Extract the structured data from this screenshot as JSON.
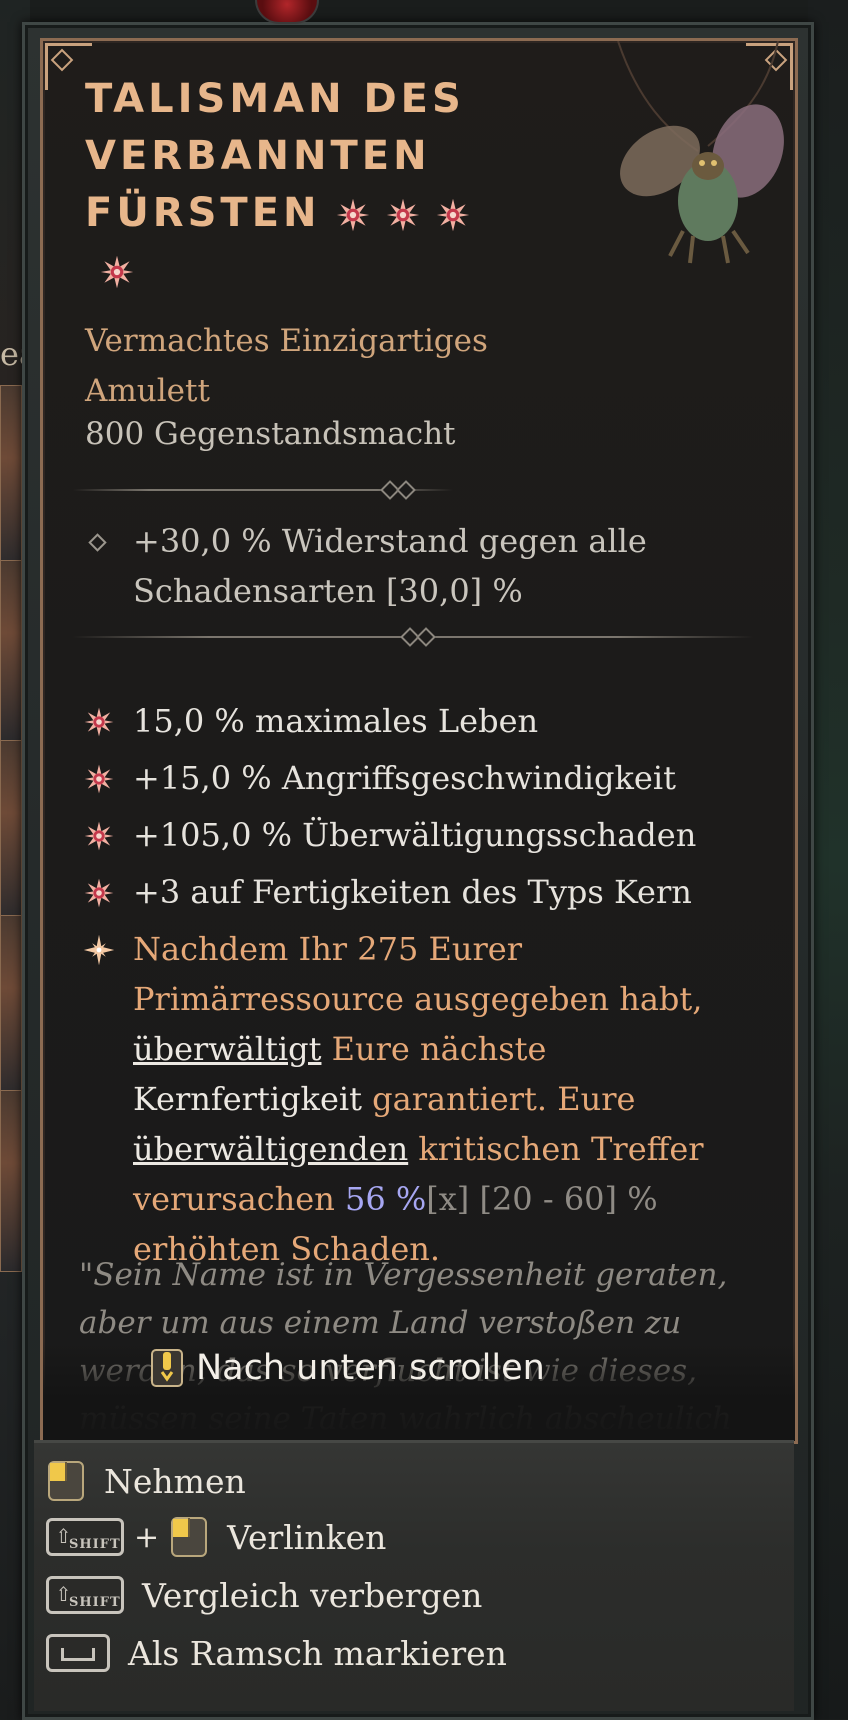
{
  "item": {
    "title_lines": [
      "Talisman des",
      "verbannten",
      "Fürsten"
    ],
    "rank_stars": 4,
    "subtype_lines": [
      "Vermachtes Einzigartiges",
      "Amulett"
    ],
    "item_power": "800 Gegenstandsmacht",
    "implicit": [
      "+30,0 % Widerstand gegen alle",
      "Schadensarten [30,0] %"
    ],
    "affixes": [
      "15,0 % maximales Leben",
      "+15,0 % Angriffsgeschwindigkeit",
      "+105,0 % Überwältigungsschaden",
      "+3 auf Fertigkeiten des Typs Kern"
    ],
    "unique_power": {
      "part1": "Nachdem Ihr 275 Eurer Primärressource ausgegeben habt, ",
      "link1": "überwältigt",
      "part2": " Eure nächste ",
      "white1": "Kernfertigkeit",
      "part3": " garantiert. Eure ",
      "link2": "überwältigenden",
      "part4": " kritischen Treffer verursachen ",
      "value": "56 %",
      "range": "[x] [20 - 60] %",
      "part5": " erhöhten Schaden."
    },
    "flavor": "\"Sein Name ist in Vergessenheit geraten, aber um aus einem Land verstoßen zu werden, das so verflucht ist wie dieses, müssen seine Taten wahrlich abscheulich gewesen sein.\""
  },
  "scroll_hint": "Nach unten scrollen",
  "actions": {
    "take": "Nehmen",
    "link": "Verlinken",
    "hide_compare": "Vergleich verbergen",
    "mark_junk": "Als Ramsch markieren",
    "shift_key": "SHIFT",
    "plus": "+"
  },
  "background": {
    "left_fragment": "ea"
  },
  "colors": {
    "title": "#e7b68b",
    "subtype": "#d0a57c",
    "unique_text": "#e5a878",
    "value_highlight": "#a7a7f2",
    "frame": "#8c6b52"
  },
  "icons": [
    "rank-star-icon",
    "affix-star-icon",
    "unique-sparkle-icon",
    "mouse-left-icon",
    "shift-key-icon",
    "space-key-icon",
    "diamond-bullet-icon"
  ]
}
